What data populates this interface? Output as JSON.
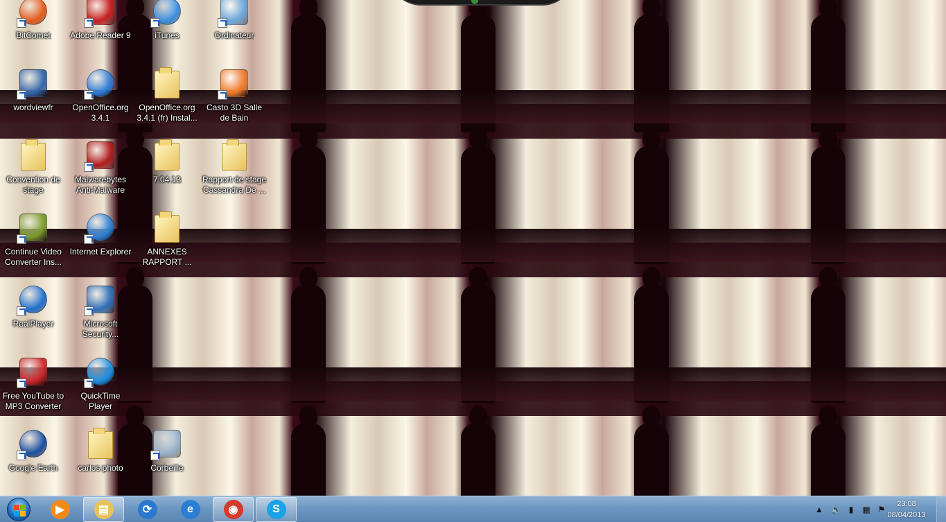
{
  "desktop": {
    "icons": [
      {
        "label": "BitComet",
        "icon": "bitcomet-icon",
        "color": "#e45a1c"
      },
      {
        "label": "Adobe Reader 9",
        "icon": "adobe-reader-icon",
        "color": "#c81e1e"
      },
      {
        "label": "iTunes",
        "icon": "itunes-icon",
        "color": "#3c8fe0"
      },
      {
        "label": "Ordinateur",
        "icon": "computer-icon",
        "color": "#6aa6d8"
      },
      {
        "label": "wordviewfr",
        "icon": "installer-icon",
        "color": "#3366aa"
      },
      {
        "label": "OpenOffice.org 3.4.1",
        "icon": "openoffice-icon",
        "color": "#2c7bd6"
      },
      {
        "label": "OpenOffice.org 3.4.1 (fr) Instal...",
        "icon": "folder-icon",
        "color": "#e8c35d"
      },
      {
        "label": "Casto 3D Salle de Bain",
        "icon": "casto3d-icon",
        "color": "#f07a2a"
      },
      {
        "label": "Convention de stage",
        "icon": "folder-icon",
        "color": "#e8c35d"
      },
      {
        "label": "Malwarebytes Anti-Malware",
        "icon": "malwarebytes-icon",
        "color": "#b01a1a"
      },
      {
        "label": "7.04.13",
        "icon": "folder-icon",
        "color": "#e8c35d"
      },
      {
        "label": "Rapport de stage Cassandra De ...",
        "icon": "folder-icon",
        "color": "#e8c35d"
      },
      {
        "label": "Continue Video Converter Ins...",
        "icon": "video-converter-icon",
        "color": "#7a9a2c"
      },
      {
        "label": "Internet Explorer",
        "icon": "internet-explorer-icon",
        "color": "#2a7fd4"
      },
      {
        "label": "ANNEXES RAPPORT ...",
        "icon": "folder-icon",
        "color": "#e8c35d"
      },
      {
        "label": "RealPlayer",
        "icon": "realplayer-icon",
        "color": "#1f6fd0"
      },
      {
        "label": "Microsoft Security...",
        "icon": "microsoft-security-icon",
        "color": "#2f6fb8"
      },
      {
        "label": "Free YouTube to MP3 Converter",
        "icon": "mp3-converter-icon",
        "color": "#d0282c"
      },
      {
        "label": "QuickTime Player",
        "icon": "quicktime-icon",
        "color": "#1e8fe0"
      },
      {
        "label": "Google Earth",
        "icon": "google-earth-icon",
        "color": "#1a4fa0"
      },
      {
        "label": "carlos photo",
        "icon": "folder-icon",
        "color": "#e8c35d"
      },
      {
        "label": "Corbeille",
        "icon": "recycle-bin-icon",
        "color": "#9ab4cc"
      }
    ]
  },
  "taskbar": {
    "pinned": [
      {
        "name": "windows-media-player",
        "icon": "media-player-icon",
        "glyph": "▶",
        "color": "#f08a1c",
        "active": false
      },
      {
        "name": "windows-explorer",
        "icon": "folder-icon",
        "glyph": "▤",
        "color": "#e8c35d",
        "active": true
      },
      {
        "name": "sync-app",
        "icon": "sync-icon",
        "glyph": "⟳",
        "color": "#2a78d0",
        "active": false
      },
      {
        "name": "internet-explorer",
        "icon": "internet-explorer-icon",
        "glyph": "e",
        "color": "#2a7fd4",
        "active": false
      },
      {
        "name": "google-chrome",
        "icon": "chrome-icon",
        "glyph": "◉",
        "color": "#d9392c",
        "active": true
      },
      {
        "name": "skype",
        "icon": "skype-icon",
        "glyph": "S",
        "color": "#1aa3e8",
        "active": true
      }
    ],
    "tray": {
      "icons": [
        "show-hidden-icons-icon",
        "volume-icon",
        "power-icon",
        "network-icon",
        "action-center-flag-icon"
      ],
      "time": "23:08",
      "date": "08/04/2013"
    }
  }
}
